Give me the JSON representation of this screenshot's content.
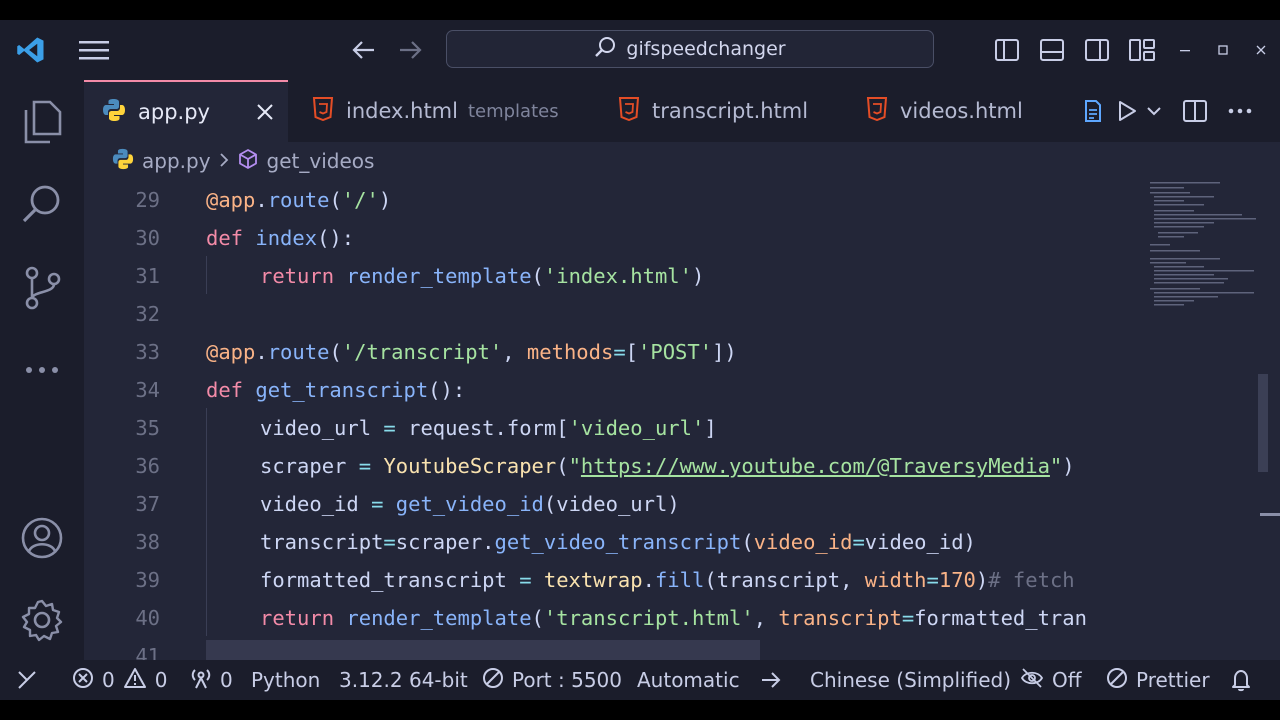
{
  "search": {
    "text": "gifspeedchanger"
  },
  "tabs": [
    {
      "label": "app.py",
      "sub": ""
    },
    {
      "label": "index.html",
      "sub": "templates"
    },
    {
      "label": "transcript.html",
      "sub": ""
    },
    {
      "label": "videos.html",
      "sub": ""
    }
  ],
  "breadcrumb": {
    "file": "app.py",
    "symbol": "get_videos"
  },
  "lines": [
    {
      "n": "29",
      "indent": 0,
      "tokens": [
        [
          "@app",
          "c-dec"
        ],
        [
          ".",
          "c-pl"
        ],
        [
          "route",
          "c-fn"
        ],
        [
          "(",
          "c-br"
        ],
        [
          "'/'",
          "c-str"
        ],
        [
          ")",
          "c-br"
        ]
      ]
    },
    {
      "n": "30",
      "indent": 0,
      "tokens": [
        [
          "def ",
          "c-ret"
        ],
        [
          "index",
          "c-fn"
        ],
        [
          "():",
          "c-pl"
        ]
      ]
    },
    {
      "n": "31",
      "indent": 1,
      "tokens": [
        [
          "return ",
          "c-ret"
        ],
        [
          "render_template",
          "c-fn"
        ],
        [
          "(",
          "c-br"
        ],
        [
          "'index.html'",
          "c-str"
        ],
        [
          ")",
          "c-br"
        ]
      ]
    },
    {
      "n": "32",
      "indent": 0,
      "tokens": []
    },
    {
      "n": "33",
      "indent": 0,
      "tokens": [
        [
          "@app",
          "c-dec"
        ],
        [
          ".",
          "c-pl"
        ],
        [
          "route",
          "c-fn"
        ],
        [
          "(",
          "c-br"
        ],
        [
          "'/transcript'",
          "c-str"
        ],
        [
          ", ",
          "c-pl"
        ],
        [
          "methods",
          "c-prm"
        ],
        [
          "=",
          "c-op"
        ],
        [
          "[",
          "c-br"
        ],
        [
          "'POST'",
          "c-str"
        ],
        [
          "])",
          "c-br"
        ]
      ]
    },
    {
      "n": "34",
      "indent": 0,
      "tokens": [
        [
          "def ",
          "c-ret"
        ],
        [
          "get_transcript",
          "c-fn"
        ],
        [
          "():",
          "c-pl"
        ]
      ]
    },
    {
      "n": "35",
      "indent": 1,
      "tokens": [
        [
          "video_url ",
          "c-pl"
        ],
        [
          "= ",
          "c-op"
        ],
        [
          "request.form",
          "c-pl"
        ],
        [
          "[",
          "c-br"
        ],
        [
          "'video_url'",
          "c-str"
        ],
        [
          "]",
          "c-br"
        ]
      ]
    },
    {
      "n": "36",
      "indent": 1,
      "tokens": [
        [
          "scraper ",
          "c-pl"
        ],
        [
          "= ",
          "c-op"
        ],
        [
          "YoutubeScraper",
          "c-cls"
        ],
        [
          "(",
          "c-br"
        ],
        [
          "\"",
          "c-str"
        ],
        [
          "https://www.youtube.com/@TraversyMedia",
          "c-url"
        ],
        [
          "\"",
          "c-str"
        ],
        [
          ")",
          "c-br"
        ]
      ]
    },
    {
      "n": "37",
      "indent": 1,
      "tokens": [
        [
          "video_id ",
          "c-pl"
        ],
        [
          "= ",
          "c-op"
        ],
        [
          "get_video_id",
          "c-fn"
        ],
        [
          "(",
          "c-br"
        ],
        [
          "video_url",
          "c-pl"
        ],
        [
          ")",
          "c-br"
        ]
      ]
    },
    {
      "n": "38",
      "indent": 1,
      "tokens": [
        [
          "transcript",
          "c-pl"
        ],
        [
          "=",
          "c-op"
        ],
        [
          "scraper.",
          "c-pl"
        ],
        [
          "get_video_transcript",
          "c-fn"
        ],
        [
          "(",
          "c-br"
        ],
        [
          "video_id",
          "c-prm"
        ],
        [
          "=",
          "c-op"
        ],
        [
          "video_id",
          "c-pl"
        ],
        [
          ")",
          "c-br"
        ]
      ]
    },
    {
      "n": "39",
      "indent": 1,
      "tokens": [
        [
          "formatted_transcript ",
          "c-pl"
        ],
        [
          "= ",
          "c-op"
        ],
        [
          "textwrap",
          "c-cls"
        ],
        [
          ".",
          "c-pl"
        ],
        [
          "fill",
          "c-fn"
        ],
        [
          "(",
          "c-br"
        ],
        [
          "transcript, ",
          "c-pl"
        ],
        [
          "width",
          "c-prm"
        ],
        [
          "=",
          "c-op"
        ],
        [
          "170",
          "c-dec"
        ],
        [
          ")",
          "c-br"
        ],
        [
          "# fetch",
          "c-cm"
        ]
      ]
    },
    {
      "n": "40",
      "indent": 1,
      "tokens": [
        [
          "return ",
          "c-ret"
        ],
        [
          "render_template",
          "c-fn"
        ],
        [
          "(",
          "c-br"
        ],
        [
          "'transcript.html'",
          "c-str"
        ],
        [
          ", ",
          "c-pl"
        ],
        [
          "transcript",
          "c-prm"
        ],
        [
          "=",
          "c-op"
        ],
        [
          "formatted_tran",
          "c-pl"
        ]
      ]
    },
    {
      "n": "41",
      "indent": 0,
      "tokens": []
    }
  ],
  "status": {
    "errors": "0",
    "warnings": "0",
    "ports": "0",
    "language": "Python",
    "interpreter": "3.12.2 64-bit",
    "port": "Port : 5500",
    "mode": "Automatic",
    "locale": "Chinese (Simplified)",
    "copilot": "Off",
    "formatter": "Prettier"
  },
  "colors": {
    "accent": "#f38ba8",
    "bg": "#232638",
    "chrome": "#1b1d2b"
  },
  "icons": [
    "vscode-logo-icon",
    "menu-icon",
    "back-arrow-icon",
    "forward-arrow-icon",
    "search-icon",
    "layout-sidebar-left-icon",
    "layout-panel-icon",
    "layout-sidebar-right-icon",
    "customize-layout-icon",
    "minimize-icon",
    "maximize-icon",
    "close-window-icon",
    "explorer-icon",
    "search-view-icon",
    "source-control-icon",
    "more-icon",
    "account-icon",
    "settings-gear-icon",
    "python-icon",
    "html5-icon",
    "close-icon",
    "preview-icon",
    "run-icon",
    "split-editor-icon",
    "remote-icon",
    "error-icon",
    "warning-icon",
    "broadcast-icon",
    "port-icon",
    "arrow-right-icon",
    "bell-icon",
    "cube-icon"
  ]
}
